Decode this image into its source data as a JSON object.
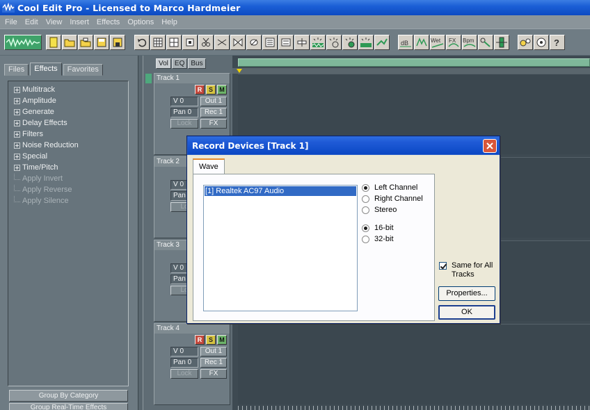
{
  "window": {
    "title": "Cool Edit Pro  - Licensed to Marco Hardmeier"
  },
  "menu": [
    "File",
    "Edit",
    "View",
    "Insert",
    "Effects",
    "Options",
    "Help"
  ],
  "toolbar_buttons": [
    {
      "name": "waveform-toggle",
      "icon": "waveform-icon"
    },
    {
      "name": "new-file",
      "icon": "new-file-icon"
    },
    {
      "name": "open-file",
      "icon": "open-folder-icon"
    },
    {
      "name": "open-append",
      "icon": "open-append-icon"
    },
    {
      "name": "save",
      "icon": "floppy-icon"
    },
    {
      "name": "save-all",
      "icon": "save-all-icon"
    },
    {
      "name": "undo",
      "icon": "undo-icon"
    },
    {
      "name": "view-1",
      "icon": "grid-icon"
    },
    {
      "name": "view-2",
      "icon": "grid-icon"
    },
    {
      "name": "view-3",
      "icon": "crop-icon"
    },
    {
      "name": "cut",
      "icon": "scissors-icon"
    },
    {
      "name": "mix",
      "icon": "mix-icon"
    },
    {
      "name": "merge",
      "icon": "merge-icon"
    },
    {
      "name": "envelope",
      "icon": "envelope-icon"
    },
    {
      "name": "mixdown",
      "icon": "mixdown-icon"
    },
    {
      "name": "track-eq",
      "icon": "eq-icon"
    },
    {
      "name": "level",
      "icon": "level-icon"
    },
    {
      "name": "fx-1",
      "icon": "sparkle-icon"
    },
    {
      "name": "fx-2",
      "icon": "sparkle-icon"
    },
    {
      "name": "fx-3",
      "icon": "sparkle-icon"
    },
    {
      "name": "fx-4",
      "icon": "sparkle-icon"
    },
    {
      "name": "fx-5",
      "icon": "sparkle-icon"
    },
    {
      "name": "db",
      "label": "dB",
      "icon": "db-icon"
    },
    {
      "name": "lr",
      "icon": "lr-icon"
    },
    {
      "name": "wet",
      "label": "Wet",
      "icon": "wet-icon"
    },
    {
      "name": "fx",
      "label": "FX",
      "icon": "fx-icon"
    },
    {
      "name": "bpm",
      "label": "Bpm",
      "icon": "bpm-icon"
    },
    {
      "name": "link",
      "icon": "link-icon"
    },
    {
      "name": "meter",
      "icon": "meter-icon"
    },
    {
      "name": "settings",
      "icon": "settings-icon"
    },
    {
      "name": "cd",
      "icon": "cd-icon"
    },
    {
      "name": "help",
      "label": "?",
      "icon": "help-icon"
    }
  ],
  "left_panel": {
    "tabs": [
      {
        "label": "Files",
        "active": false
      },
      {
        "label": "Effects",
        "active": true
      },
      {
        "label": "Favorites",
        "active": false
      }
    ],
    "tree": [
      {
        "label": "Multitrack",
        "expandable": true
      },
      {
        "label": "Amplitude",
        "expandable": true
      },
      {
        "label": "Generate",
        "expandable": true
      },
      {
        "label": "Delay Effects",
        "expandable": true
      },
      {
        "label": "Filters",
        "expandable": true
      },
      {
        "label": "Noise Reduction",
        "expandable": true
      },
      {
        "label": "Special",
        "expandable": true
      },
      {
        "label": "Time/Pitch",
        "expandable": true
      },
      {
        "label": "Apply Invert",
        "expandable": false
      },
      {
        "label": "Apply Reverse",
        "expandable": false
      },
      {
        "label": "Apply Silence",
        "expandable": false
      }
    ],
    "group_by_category": "Group By Category",
    "group_realtime": "Group Real-Time Effects"
  },
  "track_panel": {
    "tabs": [
      "Vol",
      "EQ",
      "Bus"
    ],
    "rsm": {
      "r": "R",
      "s": "S",
      "m": "M"
    },
    "tracks": [
      {
        "name": "Track 1",
        "volume": "V 0",
        "pan": "Pan 0",
        "out": "Out 1",
        "rec": "Rec 1",
        "lock": "Lock",
        "fx": "FX"
      },
      {
        "name": "Track 2",
        "volume": "V 0",
        "pan": "Pan",
        "out": "",
        "rec": "",
        "lock": "Lo",
        "fx": ""
      },
      {
        "name": "Track 3",
        "volume": "V 0",
        "pan": "Pan",
        "out": "",
        "rec": "",
        "lock": "Lo",
        "fx": ""
      },
      {
        "name": "Track 4",
        "volume": "V 0",
        "pan": "Pan 0",
        "out": "Out 1",
        "rec": "Rec 1",
        "lock": "Lock",
        "fx": "FX"
      }
    ]
  },
  "dialog": {
    "title": "Record Devices [Track 1]",
    "tab": "Wave",
    "devices": [
      "[1] Realtek AC97 Audio"
    ],
    "channels": [
      {
        "label": "Left Channel",
        "selected": true
      },
      {
        "label": "Right Channel",
        "selected": false
      },
      {
        "label": "Stereo",
        "selected": false
      }
    ],
    "bits": [
      {
        "label": "16-bit",
        "selected": true
      },
      {
        "label": "32-bit",
        "selected": false
      }
    ],
    "same_for_all": {
      "label_line1": "Same for All",
      "label_line2": "Tracks",
      "checked": true
    },
    "properties_button": "Properties...",
    "ok_button": "OK"
  }
}
